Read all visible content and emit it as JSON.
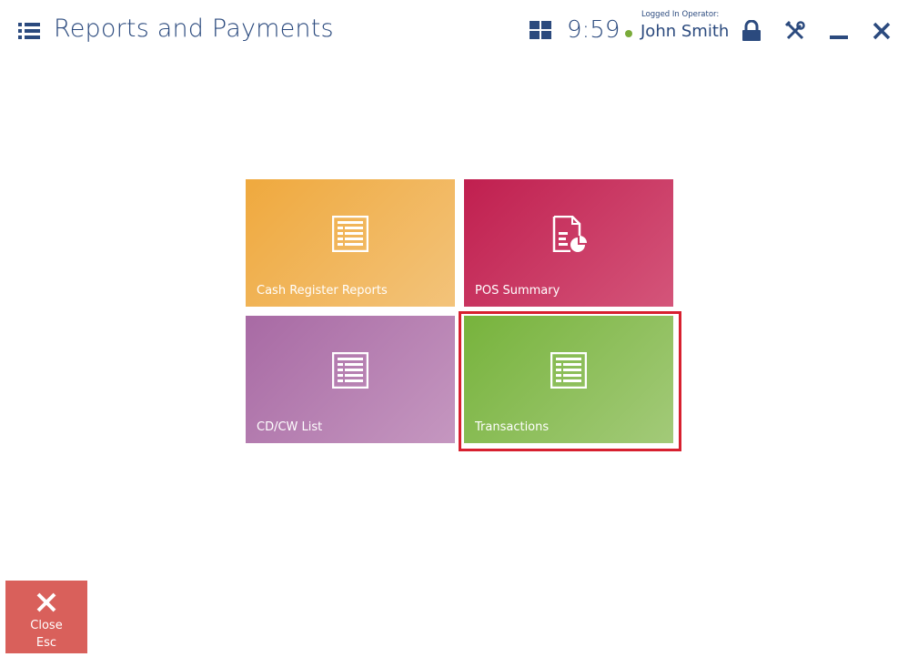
{
  "header": {
    "title": "Reports and Payments",
    "time": "9:59",
    "operator_label": "Logged In Operator:",
    "operator_name": "John Smith",
    "status_color": "#7aab3a",
    "icons": [
      "menu-icon",
      "grid-icon",
      "lock-icon",
      "tools-icon",
      "minimize-icon",
      "close-icon"
    ]
  },
  "tiles": [
    {
      "label": "Cash Register Reports",
      "icon": "list-icon",
      "color": "#efa93e"
    },
    {
      "label": "POS Summary",
      "icon": "document-chart-icon",
      "color": "#c01f4f"
    },
    {
      "label": "CD/CW List",
      "icon": "list-icon",
      "color": "#a86aa4"
    },
    {
      "label": "Transactions",
      "icon": "list-icon",
      "color": "#77b33c",
      "selected": true
    }
  ],
  "selection_color": "#d7202f",
  "footer": {
    "close_label": "Close",
    "close_key": "Esc",
    "close_color": "#d9605b"
  }
}
